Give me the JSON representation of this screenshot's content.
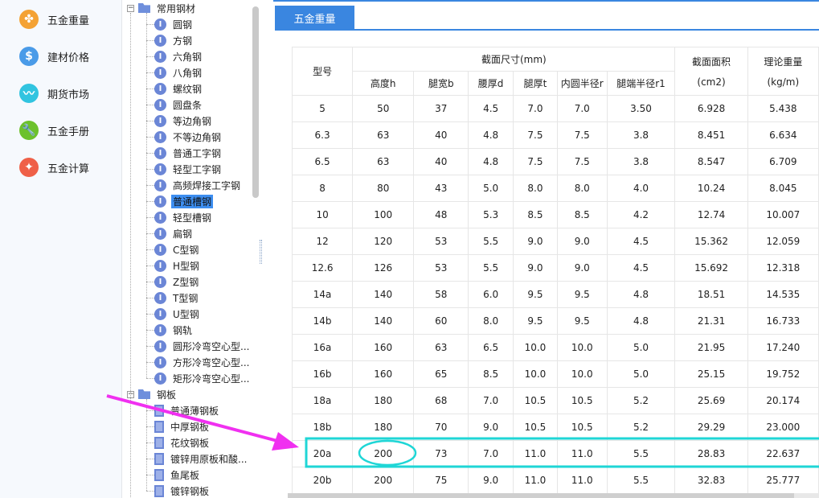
{
  "sidebar": {
    "items": [
      {
        "label": "五金重量",
        "icon": "clover-icon",
        "color": "#f4a234"
      },
      {
        "label": "建材价格",
        "icon": "dollar-icon",
        "color": "#4a9be8"
      },
      {
        "label": "期货市场",
        "icon": "trend-line-icon",
        "color": "#31c4e0"
      },
      {
        "label": "五金手册",
        "icon": "wrench-icon",
        "color": "#6cc12c"
      },
      {
        "label": "五金计算",
        "icon": "magic-wand-icon",
        "color": "#ef6048"
      }
    ]
  },
  "tree": {
    "group1": {
      "label": "常用钢材",
      "children": [
        "圆钢",
        "方钢",
        "六角钢",
        "八角钢",
        "螺纹钢",
        "圆盘条",
        "等边角钢",
        "不等边角钢",
        "普通工字钢",
        "轻型工字钢",
        "高频焊接工字钢",
        "普通槽钢",
        "轻型槽钢",
        "扁钢",
        "C型钢",
        "H型钢",
        "Z型钢",
        "T型钢",
        "U型钢",
        "钢轨",
        "圆形冷弯空心型...",
        "方形冷弯空心型...",
        "矩形冷弯空心型..."
      ],
      "selected": "普通槽钢"
    },
    "group2": {
      "label": "钢板",
      "children": [
        "普通薄钢板",
        "中厚钢板",
        "花纹钢板",
        "镀锌用原板和酸...",
        "鱼尾板",
        "镀锌钢板"
      ]
    }
  },
  "tab": {
    "label": "五金重量"
  },
  "table": {
    "h_type": "型号",
    "h_section": "截面尺寸(mm)",
    "h_area": "截面面积",
    "h_area_unit": "(cm2)",
    "h_weight": "理论重量",
    "h_weight_unit": "(kg/m)",
    "sub": [
      "高度h",
      "腿宽b",
      "腰厚d",
      "腿厚t",
      "内圆半径r",
      "腿端半径r1"
    ],
    "rows": [
      [
        "5",
        "50",
        "37",
        "4.5",
        "7.0",
        "7.0",
        "3.50",
        "6.928",
        "5.438"
      ],
      [
        "6.3",
        "63",
        "40",
        "4.8",
        "7.5",
        "7.5",
        "3.8",
        "8.451",
        "6.634"
      ],
      [
        "6.5",
        "63",
        "40",
        "4.8",
        "7.5",
        "7.5",
        "3.8",
        "8.547",
        "6.709"
      ],
      [
        "8",
        "80",
        "43",
        "5.0",
        "8.0",
        "8.0",
        "4.0",
        "10.24",
        "8.045"
      ],
      [
        "10",
        "100",
        "48",
        "5.3",
        "8.5",
        "8.5",
        "4.2",
        "12.74",
        "10.007"
      ],
      [
        "12",
        "120",
        "53",
        "5.5",
        "9.0",
        "9.0",
        "4.5",
        "15.362",
        "12.059"
      ],
      [
        "12.6",
        "126",
        "53",
        "5.5",
        "9.0",
        "9.0",
        "4.5",
        "15.692",
        "12.318"
      ],
      [
        "14a",
        "140",
        "58",
        "6.0",
        "9.5",
        "9.5",
        "4.8",
        "18.51",
        "14.535"
      ],
      [
        "14b",
        "140",
        "60",
        "8.0",
        "9.5",
        "9.5",
        "4.8",
        "21.31",
        "16.733"
      ],
      [
        "16a",
        "160",
        "63",
        "6.5",
        "10.0",
        "10.0",
        "5.0",
        "21.95",
        "17.240"
      ],
      [
        "16b",
        "160",
        "65",
        "8.5",
        "10.0",
        "10.0",
        "5.0",
        "25.15",
        "19.752"
      ],
      [
        "18a",
        "180",
        "68",
        "7.0",
        "10.5",
        "10.5",
        "5.2",
        "25.69",
        "20.174"
      ],
      [
        "18b",
        "180",
        "70",
        "9.0",
        "10.5",
        "10.5",
        "5.2",
        "29.29",
        "23.000"
      ],
      [
        "20a",
        "200",
        "73",
        "7.0",
        "11.0",
        "11.0",
        "5.5",
        "28.83",
        "22.637"
      ],
      [
        "20b",
        "200",
        "75",
        "9.0",
        "11.0",
        "11.0",
        "5.5",
        "32.83",
        "25.777"
      ]
    ]
  },
  "annotation": {
    "highlight_row": "20a",
    "highlight_cell": "200",
    "highlight_color": "#1fd6d6",
    "arrow_color": "#f030f0"
  }
}
